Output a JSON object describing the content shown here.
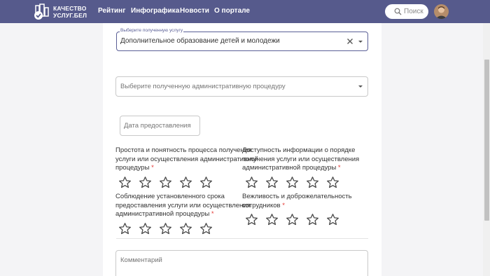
{
  "header": {
    "logo_line1": "КАЧЕСТВО",
    "logo_line2": "УСЛУГ.БЕЛ",
    "nav": [
      "Рейтинг",
      "Инфографика",
      "Новости",
      "О портале"
    ],
    "search_placeholder": "Поиск"
  },
  "form": {
    "service": {
      "legend": "Выберите полученную услугу",
      "value": "Дополнительное образование детей и молодежи"
    },
    "procedure_placeholder": "Выберите полученную административную процедуру",
    "date_placeholder": "Дата предоставления",
    "ratings": [
      {
        "lines": [
          "Простота и понятность процесса получения",
          "услуги или осуществления административной",
          "процедуры"
        ],
        "required": "*",
        "stars": 0,
        "max": 5
      },
      {
        "lines": [
          "Доступность информации о порядке",
          "получения услуги или осуществления",
          "административной процедуры"
        ],
        "required": "*",
        "stars": 0,
        "max": 5
      },
      {
        "lines": [
          "Соблюдение установленного срока",
          "предоставления услуги или осуществления",
          "административной процедуры"
        ],
        "required": "*",
        "stars": 0,
        "max": 5
      },
      {
        "lines": [
          "Вежливость и доброжелательность",
          "сотрудников"
        ],
        "required": "*",
        "stars": 0,
        "max": 5
      }
    ],
    "comment_placeholder": "Комментарий"
  },
  "colors": {
    "header_bg": "#565a8c",
    "accent": "#5a5f96",
    "required": "#e53935"
  },
  "icons": [
    "logo-icon",
    "search-icon",
    "clear-icon",
    "dropdown-arrow-icon",
    "star-outline-icon"
  ]
}
